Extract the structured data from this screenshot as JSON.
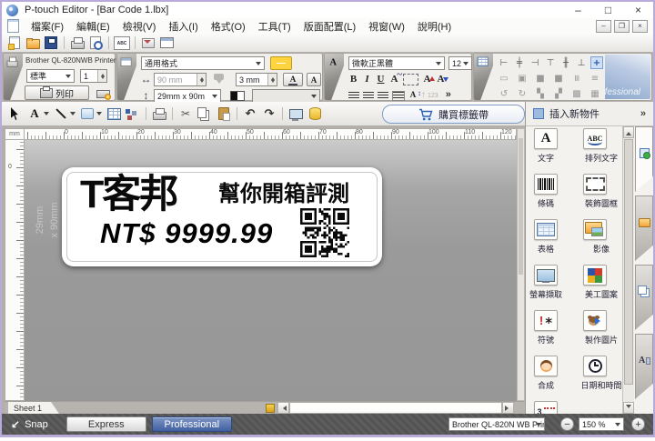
{
  "window": {
    "title": "P-touch Editor - [Bar Code 1.lbx]",
    "minimize": "–",
    "maximize": "□",
    "close": "×"
  },
  "mdi": {
    "minimize": "–",
    "restore": "❐",
    "close": "×"
  },
  "menu": {
    "items": [
      "檔案(F)",
      "編輯(E)",
      "檢視(V)",
      "插入(I)",
      "格式(O)",
      "工具(T)",
      "版面配置(L)",
      "視窗(W)",
      "說明(H)"
    ]
  },
  "toolbars": {
    "standard": [
      "new-document-icon",
      "open-icon",
      "save-icon",
      "sep",
      "print-icon",
      "print-preview-icon",
      "sep",
      "spell-check-icon",
      "sep",
      "send-email-icon",
      "layout-window-icon"
    ],
    "drawing": [
      {
        "name": "select-cursor-icon"
      },
      {
        "name": "text-tool-icon",
        "dd": true
      },
      {
        "name": "line-tool-icon",
        "dd": true
      },
      {
        "name": "shape-tool-icon",
        "dd": true
      },
      {
        "name": "table-tool-icon"
      },
      {
        "name": "arrange-object-icon"
      },
      {
        "name": "sep"
      },
      {
        "name": "print-quick-icon"
      },
      {
        "name": "sep"
      },
      {
        "name": "cut-icon"
      },
      {
        "name": "copy-icon"
      },
      {
        "name": "paste-icon"
      },
      {
        "name": "sep"
      },
      {
        "name": "undo-icon"
      },
      {
        "name": "redo-icon"
      },
      {
        "name": "sep"
      },
      {
        "name": "screen-capture-tool-icon"
      },
      {
        "name": "database-icon"
      }
    ]
  },
  "printer_panel": {
    "printer_name": "Brother QL-820NWB Printer",
    "media_quality": "標準",
    "copies": "1",
    "print_button": "列印"
  },
  "format_panel": {
    "format_preset": "通用格式",
    "tape_length": "90 mm",
    "margin": "3 mm",
    "media_size": "29mm x 90m"
  },
  "text_panel": {
    "font_family": "微軟正黑體",
    "font_size": "12",
    "bold": "B",
    "italic": "I",
    "underline": "U",
    "more": "»"
  },
  "arrange_panel": {
    "watermark": "Professional",
    "row1": [
      "align-left-icon",
      "align-center-icon",
      "align-right-icon",
      "align-top-icon",
      "align-middle-icon",
      "align-bottom-icon",
      "center-in-label-icon"
    ],
    "row2": [
      "size-width-icon",
      "size-frame-icon",
      "fill-a-icon",
      "fill-b-icon",
      "distribute-h-icon",
      "distribute-v-icon"
    ],
    "row3": [
      "rotate-left-icon",
      "rotate-right-icon",
      "group-icon",
      "ungroup-icon",
      "bring-front-icon",
      "send-back-icon"
    ]
  },
  "buy_button": {
    "label": "購買標籤帶"
  },
  "object_dock": {
    "title": "插入新物件",
    "more": "»",
    "items": [
      {
        "label": "文字",
        "icon": "text-object-icon"
      },
      {
        "label": "排列文字",
        "icon": "arranged-text-icon"
      },
      {
        "label": "條碼",
        "icon": "barcode-icon"
      },
      {
        "label": "裝飾圖框",
        "icon": "decorative-frame-icon"
      },
      {
        "label": "表格",
        "icon": "table-object-icon"
      },
      {
        "label": "影像",
        "icon": "image-object-icon"
      },
      {
        "label": "螢幕擷取",
        "icon": "screen-capture-icon"
      },
      {
        "label": "美工圖案",
        "icon": "clipart-icon"
      },
      {
        "label": "符號",
        "icon": "symbol-icon"
      },
      {
        "label": "製作圖片",
        "icon": "make-picture-icon"
      },
      {
        "label": "合成",
        "icon": "composite-icon"
      },
      {
        "label": "日期和時間",
        "icon": "date-time-icon"
      },
      {
        "label": "",
        "icon": "numbering-icon"
      }
    ]
  },
  "canvas": {
    "ruler_unit": "mm",
    "ruler_numbers": [
      0,
      10,
      20,
      30,
      40,
      50,
      60,
      70,
      80,
      90,
      100,
      110,
      120
    ],
    "media_line1": "29mm",
    "media_line2": "x 90mm",
    "vruler_zero": "0"
  },
  "label": {
    "logo": "T客邦",
    "tagline": "幫你開箱評測",
    "price": "NT$ 9999.99"
  },
  "sheet": {
    "tab": "Sheet 1"
  },
  "mode_bar": {
    "snap": "Snap",
    "express": "Express",
    "professional": "Professional"
  },
  "status": {
    "printer": "Brother QL-820N WB Prin",
    "zoom": "150 %",
    "zoom_out": "−",
    "zoom_in": "+"
  }
}
